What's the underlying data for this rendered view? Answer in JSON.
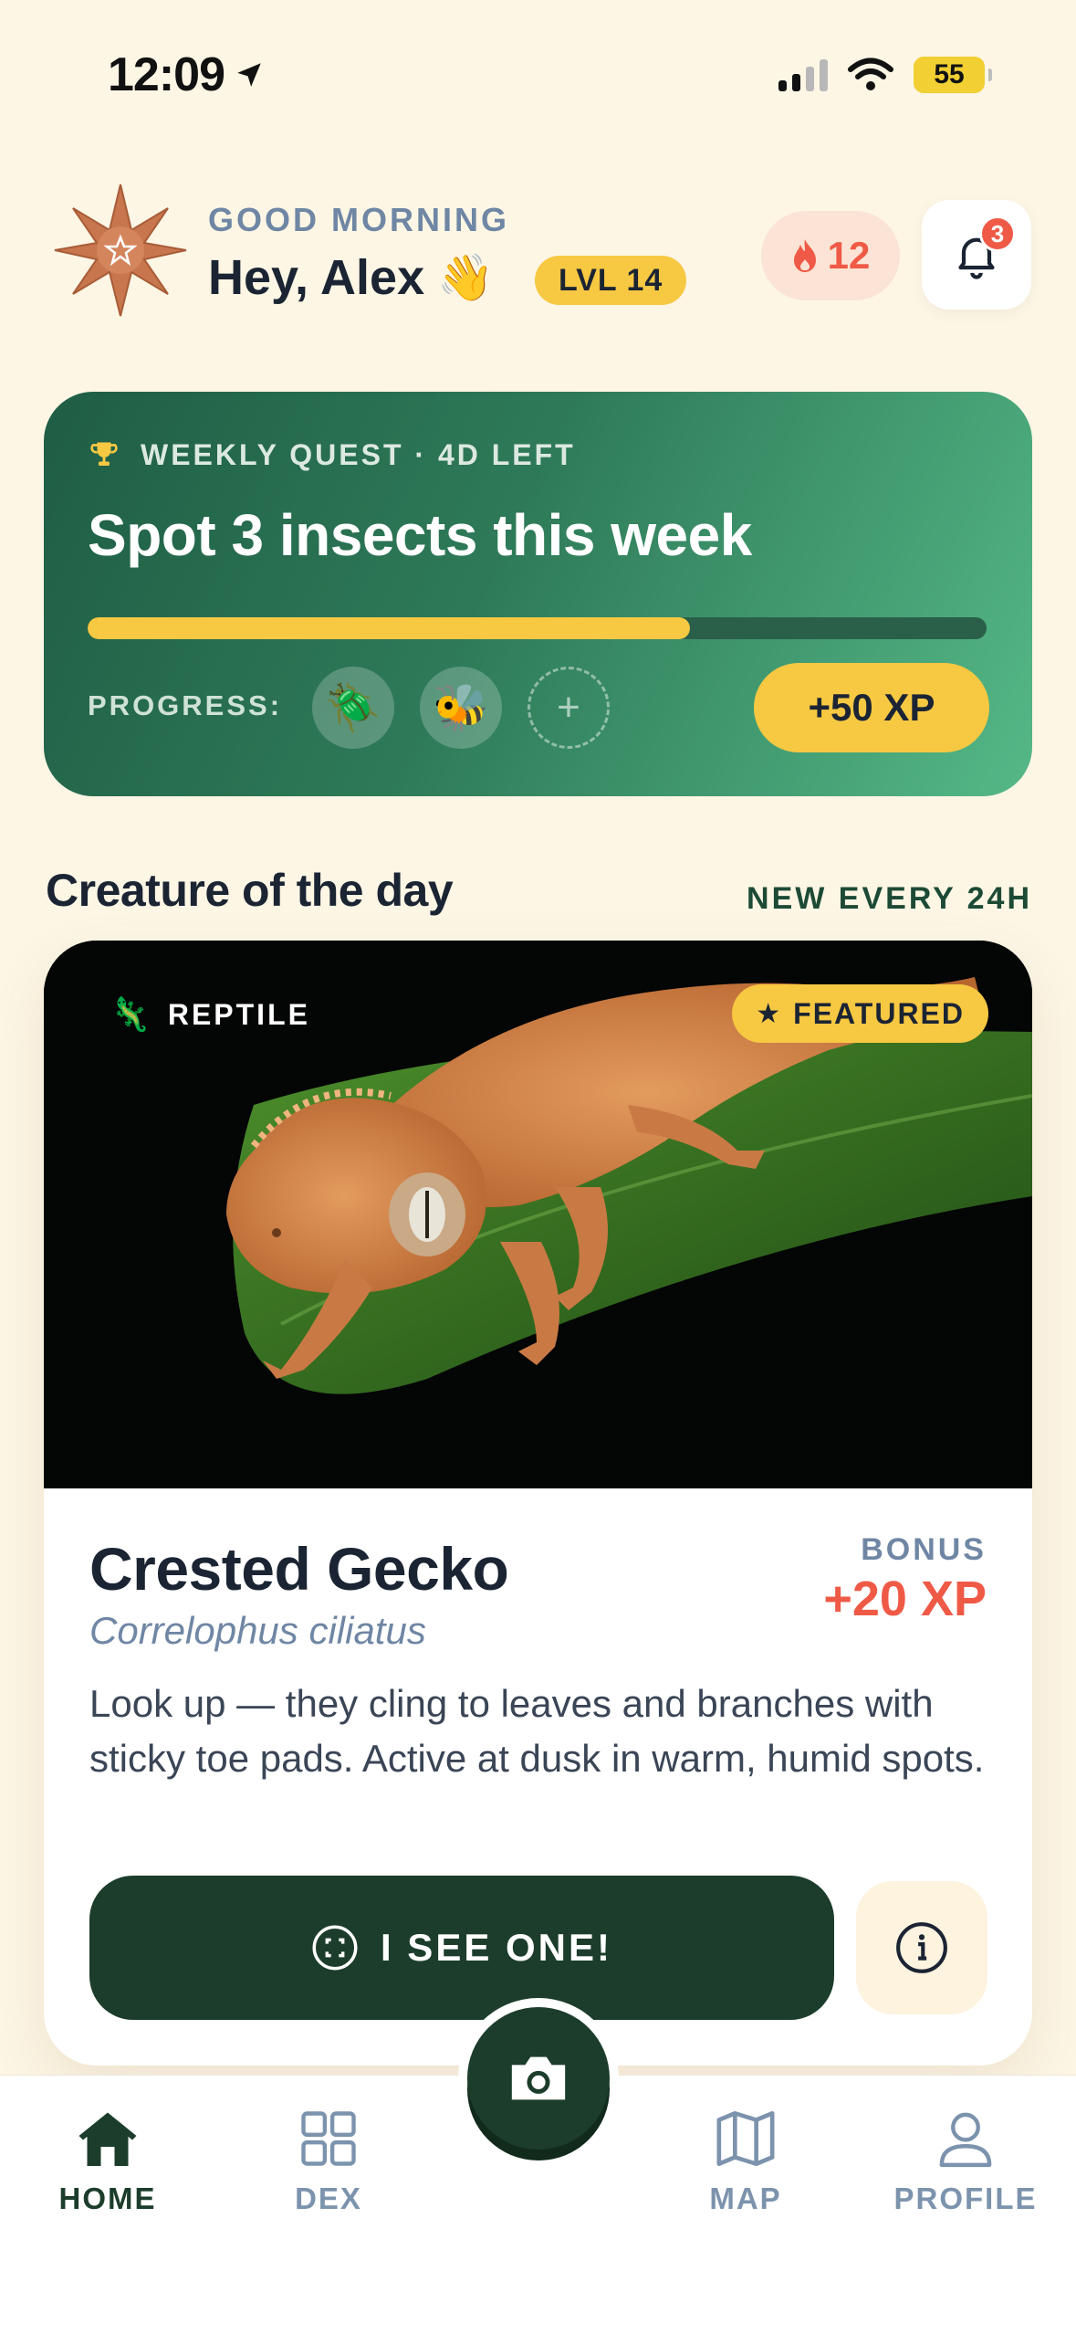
{
  "status_bar": {
    "time": "12:09",
    "battery": "55"
  },
  "header": {
    "greeting": "GOOD MORNING",
    "name": "Hey, Alex",
    "wave": "👋",
    "level": "LVL 14",
    "streak": "12",
    "notifications": "3"
  },
  "quest": {
    "heading": "WEEKLY QUEST · 4D LEFT",
    "title": "Spot 3 insects this week",
    "progress_fraction": 0.67,
    "progress_label": "PROGRESS:",
    "found": [
      "🪲",
      "🐝"
    ],
    "reward": "+50 XP"
  },
  "section": {
    "title": "Creature of the day",
    "subtitle": "NEW EVERY 24H"
  },
  "creature": {
    "category": "REPTILE",
    "category_icon": "🦎",
    "badge": "FEATURED",
    "name": "Crested Gecko",
    "scientific": "Correlophus ciliatus",
    "bonus_label": "BONUS",
    "bonus_value": "+20 XP",
    "description": "Look up — they cling to leaves and branches with sticky toe pads. Active at dusk in warm, humid spots.",
    "cta": "I SEE ONE!"
  },
  "tabs": {
    "home": "HOME",
    "dex": "DEX",
    "map": "MAP",
    "profile": "PROFILE"
  },
  "colors": {
    "background": "#fdf6e5",
    "accent_green": "#1c3d2b",
    "accent_yellow": "#f7c842",
    "accent_red": "#ef5a47"
  }
}
